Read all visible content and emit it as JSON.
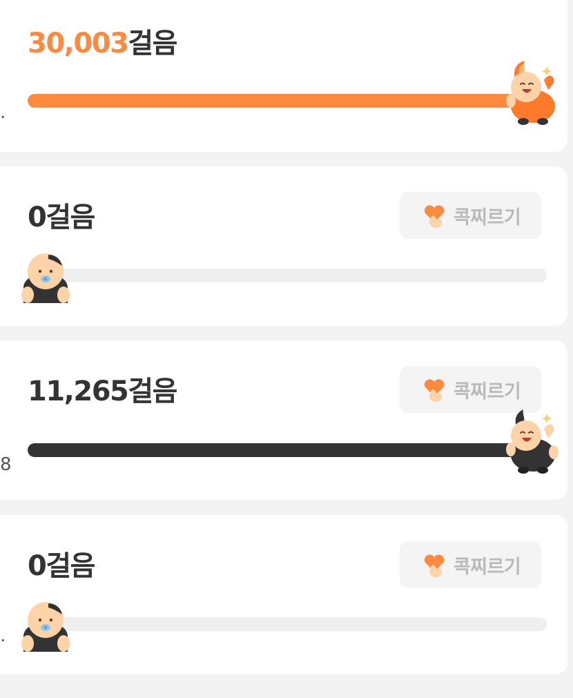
{
  "colors": {
    "accent_orange": "#ff8a3d",
    "dark_bar": "#333333",
    "track": "#efefef",
    "card_bg": "#ffffff",
    "page_bg": "#f3f3f3",
    "button_bg": "#f4f4f4",
    "button_text": "#b9b9b9",
    "heart": "#ff8a3d",
    "hand": "#ffd3a8"
  },
  "cards": [
    {
      "step_number": "30,003",
      "step_unit": "걸음",
      "progress": 1.0,
      "bar_color": "orange",
      "mascot": "orange-cheering-mascot-icon",
      "side_mark": "."
    },
    {
      "step_number": "0",
      "step_unit": "걸음",
      "progress": 0.0,
      "poke_label": "콕찌르기",
      "poke_icon": "heart-poke-icon",
      "mascot": "baby-pacifier-mascot-icon"
    },
    {
      "step_number": "11,265",
      "step_unit": "걸음",
      "progress": 1.0,
      "bar_color": "dark",
      "poke_label": "콕찌르기",
      "poke_icon": "heart-poke-icon",
      "mascot": "dark-cheering-mascot-icon",
      "side_mark": "8"
    },
    {
      "step_number": "0",
      "step_unit": "걸음",
      "progress": 0.0,
      "poke_label": "콕찌르기",
      "poke_icon": "heart-poke-icon",
      "mascot": "baby-pacifier-mascot-icon",
      "side_mark": "."
    }
  ]
}
